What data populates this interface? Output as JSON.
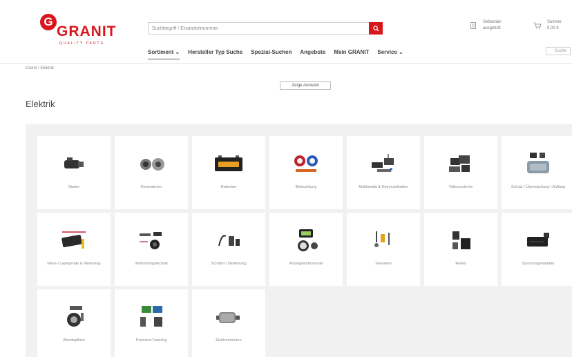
{
  "header": {
    "logo": {
      "letter": "G",
      "word": "GRANIT",
      "subtitle": "QUALITY PARTS"
    },
    "search": {
      "placeholder": "Suchbegriff / Ersatzteilnummer"
    },
    "user": {
      "line1": "Sebastian",
      "line2": "ausgefüllt"
    },
    "cart": {
      "line1": "Summe",
      "line2": "0,00 €"
    },
    "small_button": "Suche"
  },
  "nav": [
    {
      "label": "Sortiment ⌄",
      "active": true
    },
    {
      "label": "Hersteller Typ Suche",
      "active": false
    },
    {
      "label": "Spezial-Suchen",
      "active": false
    },
    {
      "label": "Angebote",
      "active": false
    },
    {
      "label": "Mein GRANIT",
      "active": false
    },
    {
      "label": "Service ⌄",
      "active": false
    }
  ],
  "breadcrumb": "Granit / Elektrik",
  "show_all_label": "Zeige Auswahl",
  "page_title": "Elektrik",
  "categories": [
    {
      "label": "Starter",
      "icon": "starter-icon"
    },
    {
      "label": "Generatoren",
      "icon": "generator-icon"
    },
    {
      "label": "Batterien",
      "icon": "battery-icon"
    },
    {
      "label": "Beleuchtung",
      "icon": "lighting-icon"
    },
    {
      "label": "Multimedia & Kommunikation",
      "icon": "multimedia-icon"
    },
    {
      "label": "Videosysteme",
      "icon": "video-icon"
    },
    {
      "label": "Schutz / Überwachung / Auflung",
      "icon": "protection-icon"
    },
    {
      "label": "Mess-/ Ladegeräte & Werkzeug",
      "icon": "charger-icon"
    },
    {
      "label": "Verbindungstechnik",
      "icon": "connector-icon"
    },
    {
      "label": "Schalter / Bedienung",
      "icon": "switch-icon"
    },
    {
      "label": "Anzeigeinstrumente",
      "icon": "gauge-icon"
    },
    {
      "label": "Sensoren",
      "icon": "sensor-icon"
    },
    {
      "label": "Relais",
      "icon": "relay-icon"
    },
    {
      "label": "Spannungswandler",
      "icon": "inverter-icon"
    },
    {
      "label": "Wendepflück",
      "icon": "wheel-icon"
    },
    {
      "label": "Precision Farming",
      "icon": "farming-icon"
    },
    {
      "label": "Elektromotoren",
      "icon": "motor-icon"
    }
  ],
  "colors": {
    "brand": "#d8161e",
    "grid_bg": "#f1f1f1"
  }
}
